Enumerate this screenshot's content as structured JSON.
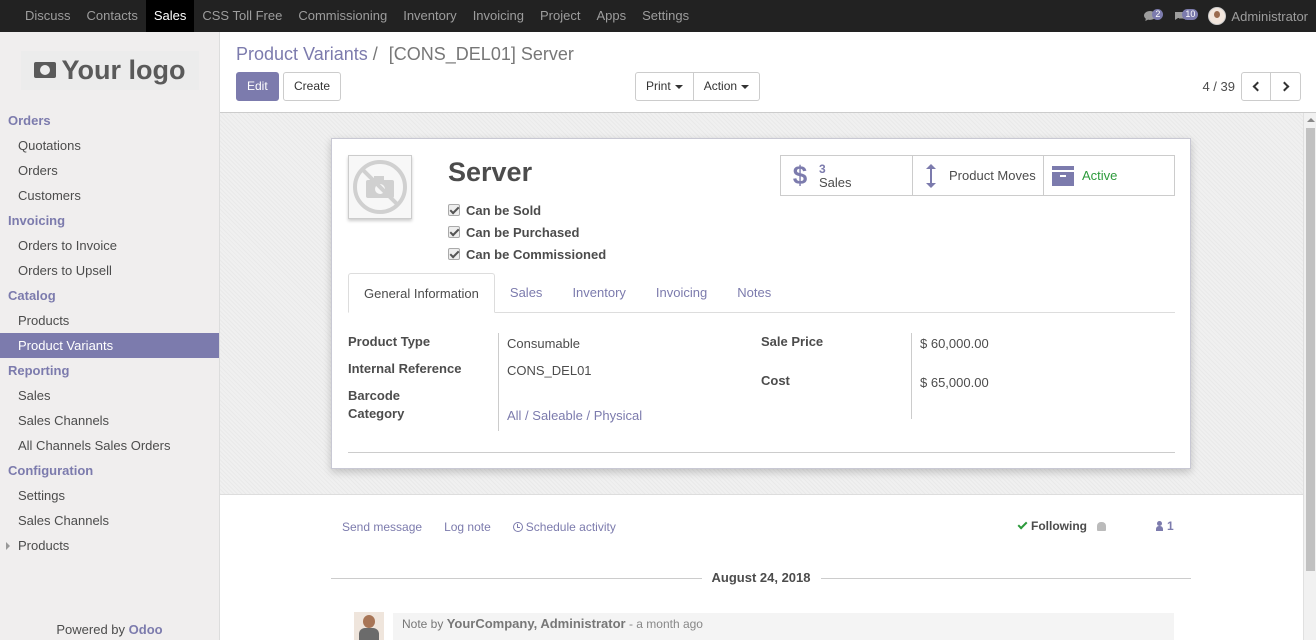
{
  "topbar": {
    "menu": [
      "Discuss",
      "Contacts",
      "Sales",
      "CSS Toll Free",
      "Commissioning",
      "Inventory",
      "Invoicing",
      "Project",
      "Apps",
      "Settings"
    ],
    "active": "Sales",
    "messages_count": "2",
    "activities_count": "10",
    "user_name": "Administrator"
  },
  "sidebar": {
    "logo_text": "Your logo",
    "sections": [
      {
        "title": "Orders",
        "items": [
          "Quotations",
          "Orders",
          "Customers"
        ]
      },
      {
        "title": "Invoicing",
        "items": [
          "Orders to Invoice",
          "Orders to Upsell"
        ]
      },
      {
        "title": "Catalog",
        "items": [
          "Products",
          "Product Variants"
        ]
      },
      {
        "title": "Reporting",
        "items": [
          "Sales",
          "Sales Channels",
          "All Channels Sales Orders"
        ]
      },
      {
        "title": "Configuration",
        "items": [
          "Settings",
          "Sales Channels",
          "Products"
        ]
      }
    ],
    "active_item": "Product Variants",
    "powered_by": "Powered by",
    "powered_brand": "Odoo"
  },
  "control_panel": {
    "breadcrumb_parent": "Product Variants",
    "breadcrumb_sep": "/",
    "breadcrumb_current": "[CONS_DEL01] Server",
    "edit_label": "Edit",
    "create_label": "Create",
    "print_label": "Print",
    "action_label": "Action",
    "pager_value": "4 / 39"
  },
  "form": {
    "name": "Server",
    "checkboxes": [
      "Can be Sold",
      "Can be Purchased",
      "Can be Commissioned"
    ],
    "smart_buttons": {
      "sales_count": "3",
      "sales_label": "Sales",
      "moves_label": "Product Moves",
      "active_label": "Active"
    },
    "tabs": [
      "General Information",
      "Sales",
      "Inventory",
      "Invoicing",
      "Notes"
    ],
    "active_tab": "General Information",
    "fields": {
      "product_type_label": "Product Type",
      "product_type": "Consumable",
      "internal_ref_label": "Internal Reference",
      "internal_ref": "CONS_DEL01",
      "barcode_label": "Barcode",
      "category_label": "Category",
      "category": "All / Saleable / Physical",
      "sale_price_label": "Sale Price",
      "sale_price": "$ 60,000.00",
      "cost_label": "Cost",
      "cost": "$ 65,000.00"
    }
  },
  "chatter": {
    "send_message": "Send message",
    "log_note": "Log note",
    "schedule_activity": "Schedule activity",
    "following": "Following",
    "followers_count": "1",
    "date_separator": "August 24, 2018",
    "message": {
      "prefix": "Note by",
      "author": "YourCompany, Administrator",
      "time": "- a month ago"
    }
  },
  "colors": {
    "brand": "#7c7bad",
    "topbar": "#222222",
    "active_green": "#2c9a3b"
  }
}
